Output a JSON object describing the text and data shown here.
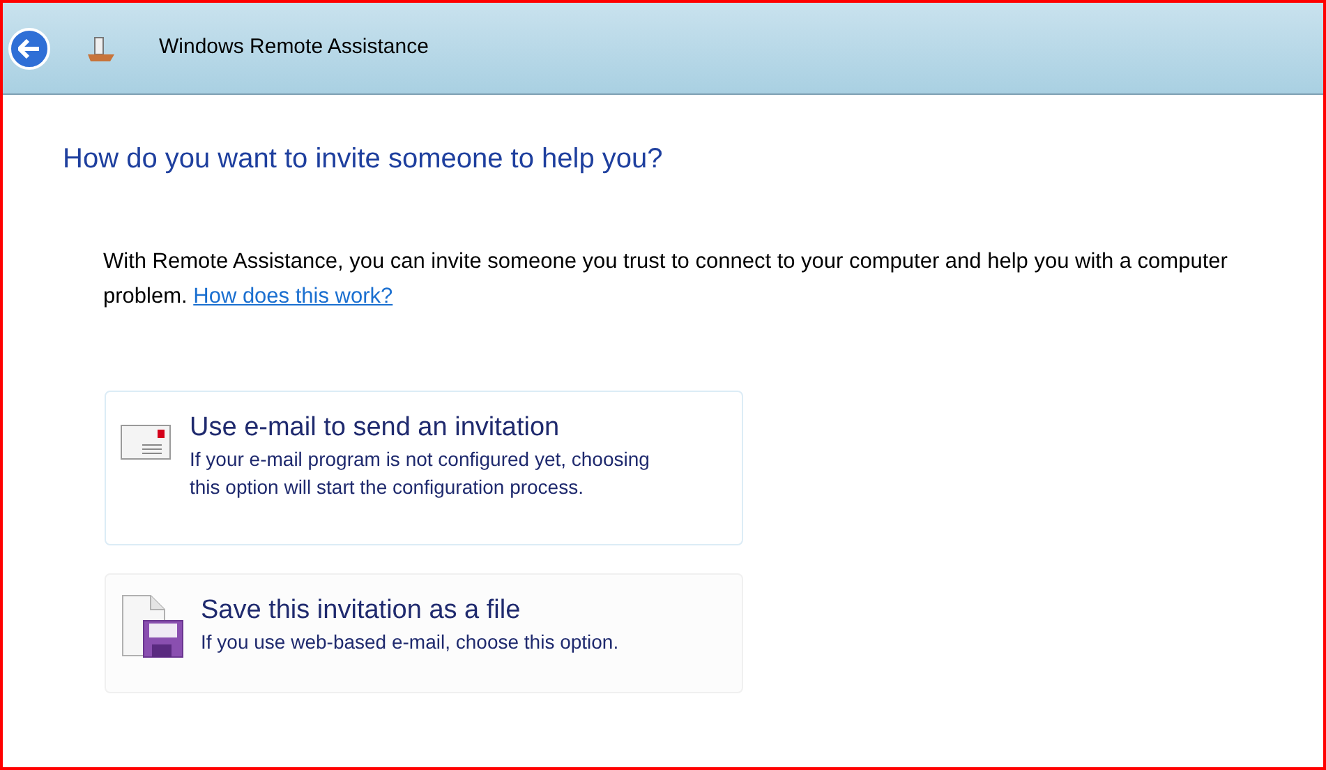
{
  "window": {
    "title": "Windows Remote Assistance"
  },
  "heading": "How do you want to invite someone to help you?",
  "intro": {
    "text": "With Remote Assistance, you can invite someone you trust to connect to your computer and help you with a computer problem.",
    "link": "How does this work?"
  },
  "options": [
    {
      "kind": "email",
      "title": "Use e-mail to send an invitation",
      "description": "If your e-mail program is not configured yet, choosing this option will start the configuration process."
    },
    {
      "kind": "file",
      "title": "Save this invitation as a file",
      "description": "If you use web-based e-mail, choose this option."
    }
  ]
}
